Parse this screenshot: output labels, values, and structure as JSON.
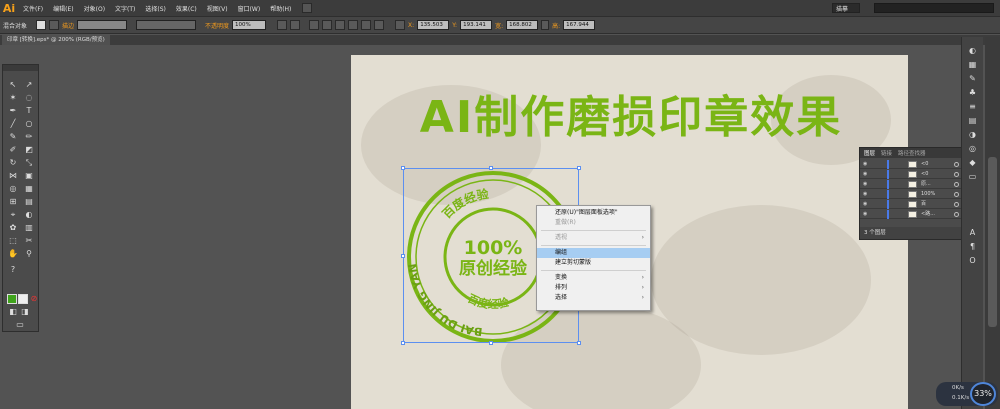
{
  "app": {
    "logo": "Ai",
    "menus": [
      "文件(F)",
      "编辑(E)",
      "对象(O)",
      "文字(T)",
      "选择(S)",
      "效果(C)",
      "视图(V)",
      "窗口(W)",
      "帮助(H)"
    ],
    "workspace": "描摹",
    "search_placeholder": ""
  },
  "control_bar": {
    "selection_label": "混合对象",
    "stroke_label": "描边",
    "opacity_label": "不透明度",
    "opacity_value": "100%",
    "x_label": "X:",
    "x_value": "135.503",
    "y_label": "Y:",
    "y_value": "193.141",
    "w_label": "宽:",
    "w_value": "168.802",
    "h_label": "高:",
    "h_value": "167.944"
  },
  "document": {
    "tab_title": "印章 [转换].eps* @ 200% (RGB/预览)"
  },
  "artboard": {
    "title": "AI制作磨损印章效果",
    "stamp_center_line1": "100%",
    "stamp_center_line2": "原创经验",
    "stamp_top_text": "百度经验",
    "stamp_left_text": "BAI DU JING YAN",
    "stamp_bottom_text": "百度经验",
    "accent_color": "#7ab515"
  },
  "context_menu": {
    "items": [
      {
        "label": "还原(U)\"图层面板选项\"",
        "disabled": false,
        "submenu": false
      },
      {
        "label": "重做(R)",
        "disabled": true,
        "submenu": false
      },
      {
        "label": "透视",
        "disabled": true,
        "submenu": true
      },
      {
        "label": "编组",
        "disabled": false,
        "submenu": false,
        "highlighted": true
      },
      {
        "label": "建立剪切蒙版",
        "disabled": false,
        "submenu": false
      },
      {
        "label": "变换",
        "disabled": false,
        "submenu": true
      },
      {
        "label": "排列",
        "disabled": false,
        "submenu": true
      },
      {
        "label": "选择",
        "disabled": false,
        "submenu": true
      }
    ]
  },
  "layers_panel": {
    "tabs": [
      "图层",
      "链接",
      "路径查找器"
    ],
    "rows": [
      {
        "name": "<0"
      },
      {
        "name": "<0"
      },
      {
        "name": "原..."
      },
      {
        "name": "100%"
      },
      {
        "name": "百"
      },
      {
        "name": "<路..."
      }
    ],
    "footer": "3 个图层"
  },
  "net_widget": {
    "percent": "33%",
    "up": "0K/s",
    "down": "0.1K/s"
  }
}
